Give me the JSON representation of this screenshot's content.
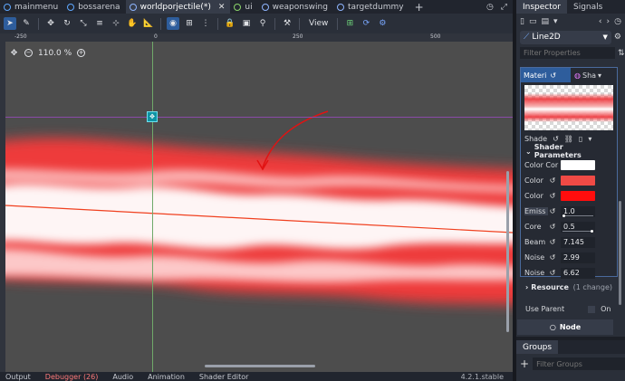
{
  "tabs": [
    {
      "label": "mainmenu",
      "icon": "scene-icon"
    },
    {
      "label": "bossarena",
      "icon": "scene-icon"
    },
    {
      "label": "worldporjectile(*)",
      "icon": "node2d-icon",
      "active": true
    },
    {
      "label": "ui",
      "icon": "ui-icon"
    },
    {
      "label": "weaponswing",
      "icon": "node2d-icon"
    },
    {
      "label": "targetdummy",
      "icon": "node2d-icon"
    }
  ],
  "toolbar": {
    "view_label": "View"
  },
  "viewport": {
    "zoom": "110.0 %",
    "ruler_labels": [
      "-250",
      "0",
      "250",
      "500"
    ]
  },
  "bottombar": {
    "output": "Output",
    "debugger": "Debugger (26)",
    "audio": "Audio",
    "animation": "Animation",
    "shader_editor": "Shader Editor",
    "version": "4.2.1.stable"
  },
  "inspector": {
    "tab_inspector": "Inspector",
    "tab_signals": "Signals",
    "node_name": "Line2D",
    "filter_placeholder": "Filter Properties",
    "material_button": "Materi",
    "shader_label": "Sha",
    "shade_label": "Shade",
    "shader_params_title": "Shader Parameters",
    "params": [
      {
        "label": "Color Cor",
        "type": "color",
        "color": "#ffffff"
      },
      {
        "label": "Color",
        "type": "color",
        "color": "#f04a45"
      },
      {
        "label": "Color",
        "type": "color",
        "color": "#ff0d0d"
      },
      {
        "label": "Emiss",
        "type": "value",
        "value": "1.0",
        "slider": 0.0
      },
      {
        "label": "Core",
        "type": "value",
        "value": "0.5",
        "slider": 0.95
      },
      {
        "label": "Beam",
        "type": "value",
        "value": "7.145"
      },
      {
        "label": "Noise",
        "type": "value",
        "value": "2.99"
      },
      {
        "label": "Noise",
        "type": "value",
        "value": "6.62"
      }
    ],
    "resource_label": "Resource",
    "resource_changes": "(1 change)",
    "use_parent_label": "Use Parent",
    "use_parent_value": "On",
    "node_section": "Node"
  },
  "groups": {
    "tab": "Groups",
    "filter_placeholder": "Filter Groups"
  },
  "colors": {
    "accent": "#2e5d9c",
    "beam_red": "#ee3b3b",
    "arrow_red": "#e11212"
  }
}
